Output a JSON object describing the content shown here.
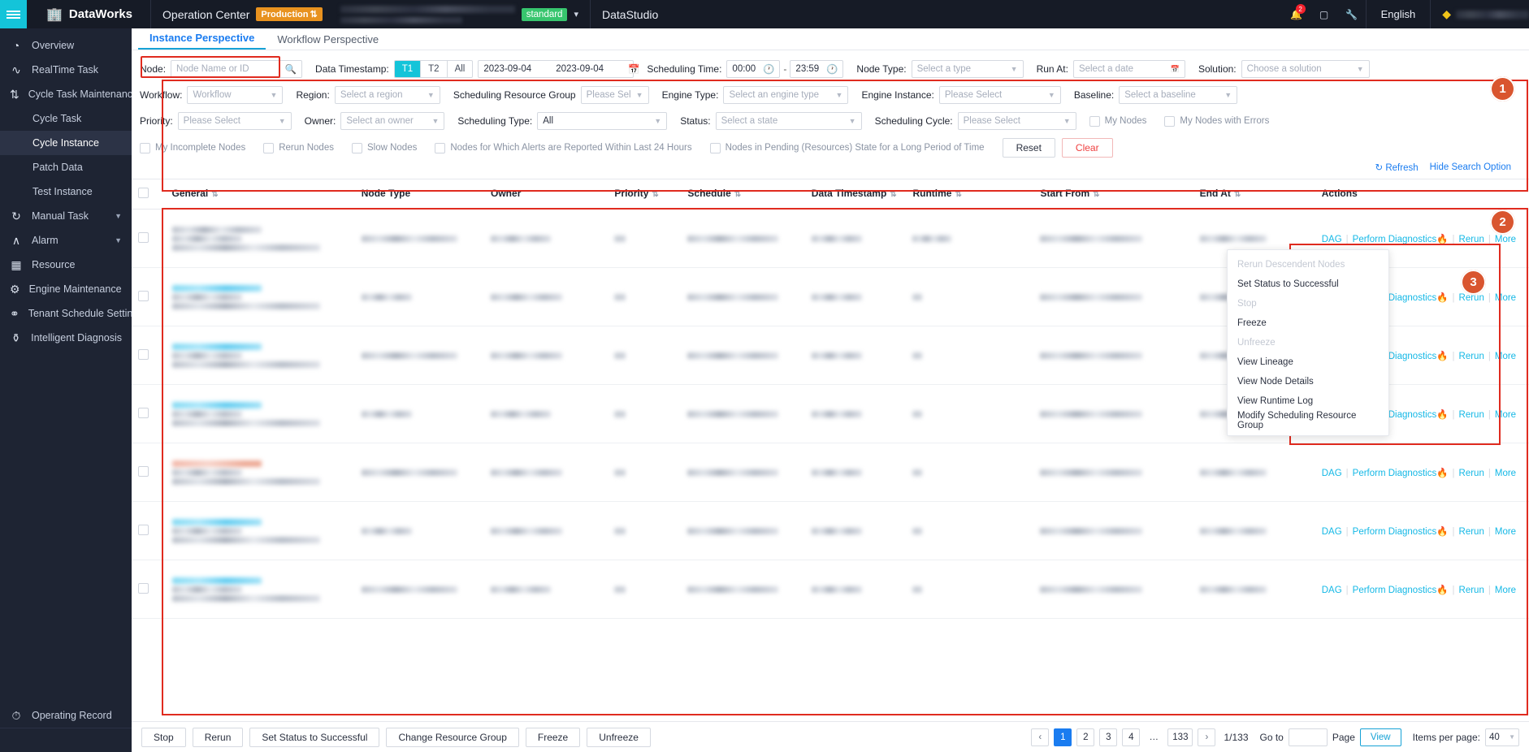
{
  "header": {
    "brand": "DataWorks",
    "nav_title": "Operation Center",
    "env_badge": "Production",
    "plan_badge": "standard",
    "workspace_link": "DataStudio",
    "notification_count": "2",
    "language": "English"
  },
  "sidebar": {
    "items": [
      {
        "label": "Overview",
        "icon": "pie-chart-icon",
        "type": "item"
      },
      {
        "label": "RealTime Task",
        "icon": "stream-icon",
        "type": "item"
      },
      {
        "label": "Cycle Task Maintenance",
        "icon": "cycle-icon",
        "type": "group",
        "expanded": true
      },
      {
        "label": "Cycle Task",
        "icon": "",
        "type": "sub"
      },
      {
        "label": "Cycle Instance",
        "icon": "",
        "type": "sub",
        "active": true
      },
      {
        "label": "Patch Data",
        "icon": "",
        "type": "sub"
      },
      {
        "label": "Test Instance",
        "icon": "",
        "type": "sub"
      },
      {
        "label": "Manual Task",
        "icon": "manual-icon",
        "type": "group"
      },
      {
        "label": "Alarm",
        "icon": "alarm-icon",
        "type": "group"
      },
      {
        "label": "Resource",
        "icon": "resource-icon",
        "type": "item"
      },
      {
        "label": "Engine Maintenance",
        "icon": "engine-icon",
        "type": "group"
      },
      {
        "label": "Tenant Schedule Setting",
        "icon": "tenant-icon",
        "type": "item"
      },
      {
        "label": "Intelligent Diagnosis",
        "icon": "diagnosis-icon",
        "type": "item"
      }
    ],
    "bottom_item": {
      "label": "Operating Record",
      "icon": "record-icon"
    }
  },
  "tabs": [
    {
      "label": "Instance Perspective",
      "active": true
    },
    {
      "label": "Workflow Perspective",
      "active": false
    }
  ],
  "filters": {
    "node_label": "Node:",
    "node_placeholder": "Node Name or ID",
    "data_timestamp_label": "Data Timestamp:",
    "timestamp_segments": [
      "T1",
      "T2",
      "All"
    ],
    "timestamp_active": "T1",
    "date_from": "2023-09-04",
    "date_to": "2023-09-04",
    "scheduling_time_label": "Scheduling Time:",
    "time_from": "00:00",
    "time_to": "23:59",
    "node_type_label": "Node Type:",
    "node_type_placeholder": "Select a type",
    "run_at_label": "Run At:",
    "run_at_placeholder": "Select a date",
    "solution_label": "Solution:",
    "solution_placeholder": "Choose a solution",
    "workflow_label": "Workflow:",
    "workflow_placeholder": "Workflow",
    "region_label": "Region:",
    "region_placeholder": "Select a region",
    "resource_group_label": "Scheduling Resource Group",
    "resource_group_placeholder": "Please Select",
    "engine_type_label": "Engine Type:",
    "engine_type_placeholder": "Select an engine type",
    "engine_instance_label": "Engine Instance:",
    "engine_instance_placeholder": "Please Select",
    "baseline_label": "Baseline:",
    "baseline_placeholder": "Select a baseline",
    "priority_label": "Priority:",
    "priority_placeholder": "Please Select",
    "owner_label": "Owner:",
    "owner_placeholder": "Select an owner",
    "scheduling_type_label": "Scheduling Type:",
    "scheduling_type_value": "All",
    "status_label": "Status:",
    "status_placeholder": "Select a state",
    "scheduling_cycle_label": "Scheduling Cycle:",
    "scheduling_cycle_placeholder": "Please Select",
    "my_nodes": "My Nodes",
    "my_nodes_errors": "My Nodes with Errors",
    "checkboxes": [
      "My Incomplete Nodes",
      "Rerun Nodes",
      "Slow Nodes",
      "Nodes for Which Alerts are Reported Within Last 24 Hours",
      "Nodes in Pending (Resources) State for a Long Period of Time"
    ],
    "reset_button": "Reset",
    "clear_button": "Clear",
    "refresh_link": "Refresh",
    "hide_search_link": "Hide Search Option"
  },
  "table": {
    "columns": [
      {
        "label": "General",
        "sortable": true
      },
      {
        "label": "Node Type",
        "sortable": false
      },
      {
        "label": "Owner",
        "sortable": false
      },
      {
        "label": "Priority",
        "sortable": true
      },
      {
        "label": "Schedule",
        "sortable": true
      },
      {
        "label": "Data Timestamp",
        "sortable": true
      },
      {
        "label": "Runtime",
        "sortable": true
      },
      {
        "label": "Start From",
        "sortable": true
      },
      {
        "label": "End At",
        "sortable": true
      },
      {
        "label": "Actions",
        "sortable": false
      }
    ],
    "row_actions": {
      "dag": "DAG",
      "diagnostics": "Perform Diagnostics",
      "rerun": "Rerun",
      "more": "More"
    },
    "rows": [
      {
        "general_tint": "none"
      },
      {
        "general_tint": "blue"
      },
      {
        "general_tint": "blue"
      },
      {
        "general_tint": "blue"
      },
      {
        "general_tint": "pink"
      },
      {
        "general_tint": "blue"
      },
      {
        "general_tint": "blue"
      }
    ]
  },
  "context_menu": {
    "items": [
      {
        "label": "Rerun Descendent Nodes",
        "disabled": true
      },
      {
        "label": "Set Status to Successful",
        "disabled": false
      },
      {
        "label": "Stop",
        "disabled": true
      },
      {
        "label": "Freeze",
        "disabled": false
      },
      {
        "label": "Unfreeze",
        "disabled": true
      },
      {
        "label": "View Lineage",
        "disabled": false
      },
      {
        "label": "View Node Details",
        "disabled": false
      },
      {
        "label": "View Runtime Log",
        "disabled": false
      },
      {
        "label": "Modify Scheduling Resource Group",
        "disabled": false
      }
    ]
  },
  "footer": {
    "buttons": [
      "Stop",
      "Rerun",
      "Set Status to Successful",
      "Change Resource Group",
      "Freeze",
      "Unfreeze"
    ],
    "pages": [
      "1",
      "2",
      "3",
      "4",
      "…",
      "133"
    ],
    "current_page": "1",
    "page_summary": "1/133",
    "goto_label": "Go to",
    "goto_value": "",
    "page_word": "Page",
    "view_button": "View",
    "items_per_page_label": "Items per page:",
    "items_per_page_value": "40"
  },
  "annotations": {
    "markers": [
      "1",
      "2",
      "3"
    ]
  }
}
